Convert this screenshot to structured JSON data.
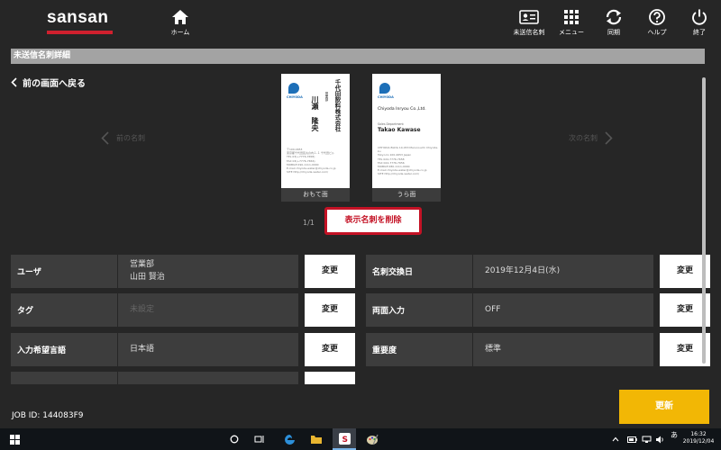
{
  "app": {
    "logo": "sansan"
  },
  "nav": {
    "home": "ホーム",
    "unsent": "未送信名刺",
    "menu": "メニュー",
    "sync": "同期",
    "help": "ヘルプ",
    "exit": "終了"
  },
  "section_title": "未送信名刺詳細",
  "back_label": "前の画面へ戻る",
  "prev_label": "前の名刺",
  "next_label": "次の名刺",
  "cards": {
    "front_caption": "おもて面",
    "back_caption": "うら面",
    "front": {
      "brand": "CHIYODA",
      "company": "千代田飲料株式会社",
      "dept": "営業部",
      "name": "川瀬　隆央",
      "details": [
        "〒100-4653",
        "東京都千代田区丸の内１-１ 千代田ビル",
        "TEL 03(+7776-7658)",
        "FAX 03(+7776-7656)",
        "MOBILE 090-1111-0000",
        "E-mail chiyoda-water@chiyoda.co.jp",
        "SITE http://chiyoda-water.com/"
      ]
    },
    "back": {
      "brand": "CHIYODA",
      "company": "Chiyoda Inryou Co.,Ltd.",
      "dept": "Sales Department",
      "name": "Takao Kawase",
      "details": [
        "CHIYODA BLDG 10-453 Marunouchi Chiyoda-ku",
        "Tokyo-to 100-4653 Japan",
        "TEL 024-7776-7658",
        "FAX 024-7776-7656",
        "MOBILE 080-1111-0000",
        "E-mail chiyoda-water@chiyoda.co.jp",
        "SITE http://chiyoda-water.com/"
      ]
    }
  },
  "page_indicator": "1/1",
  "delete_button": "表示名刺を削除",
  "edit_label": "変更",
  "fields": {
    "user": {
      "label": "ユーザ",
      "line1": "営業部",
      "line2": "山田 賢治"
    },
    "tag": {
      "label": "タグ",
      "value": "未設定"
    },
    "lang": {
      "label": "入力希望言語",
      "value": "日本語"
    },
    "exchange_date": {
      "label": "名刺交換日",
      "value": "2019年12月4日(水)"
    },
    "duplex": {
      "label": "両面入力",
      "value": "OFF"
    },
    "priority": {
      "label": "重要度",
      "value": "標準"
    }
  },
  "job_id": "JOB ID: 144083F9",
  "update_button": "更新",
  "taskbar": {
    "time": "16:32",
    "date": "2019/12/04"
  }
}
